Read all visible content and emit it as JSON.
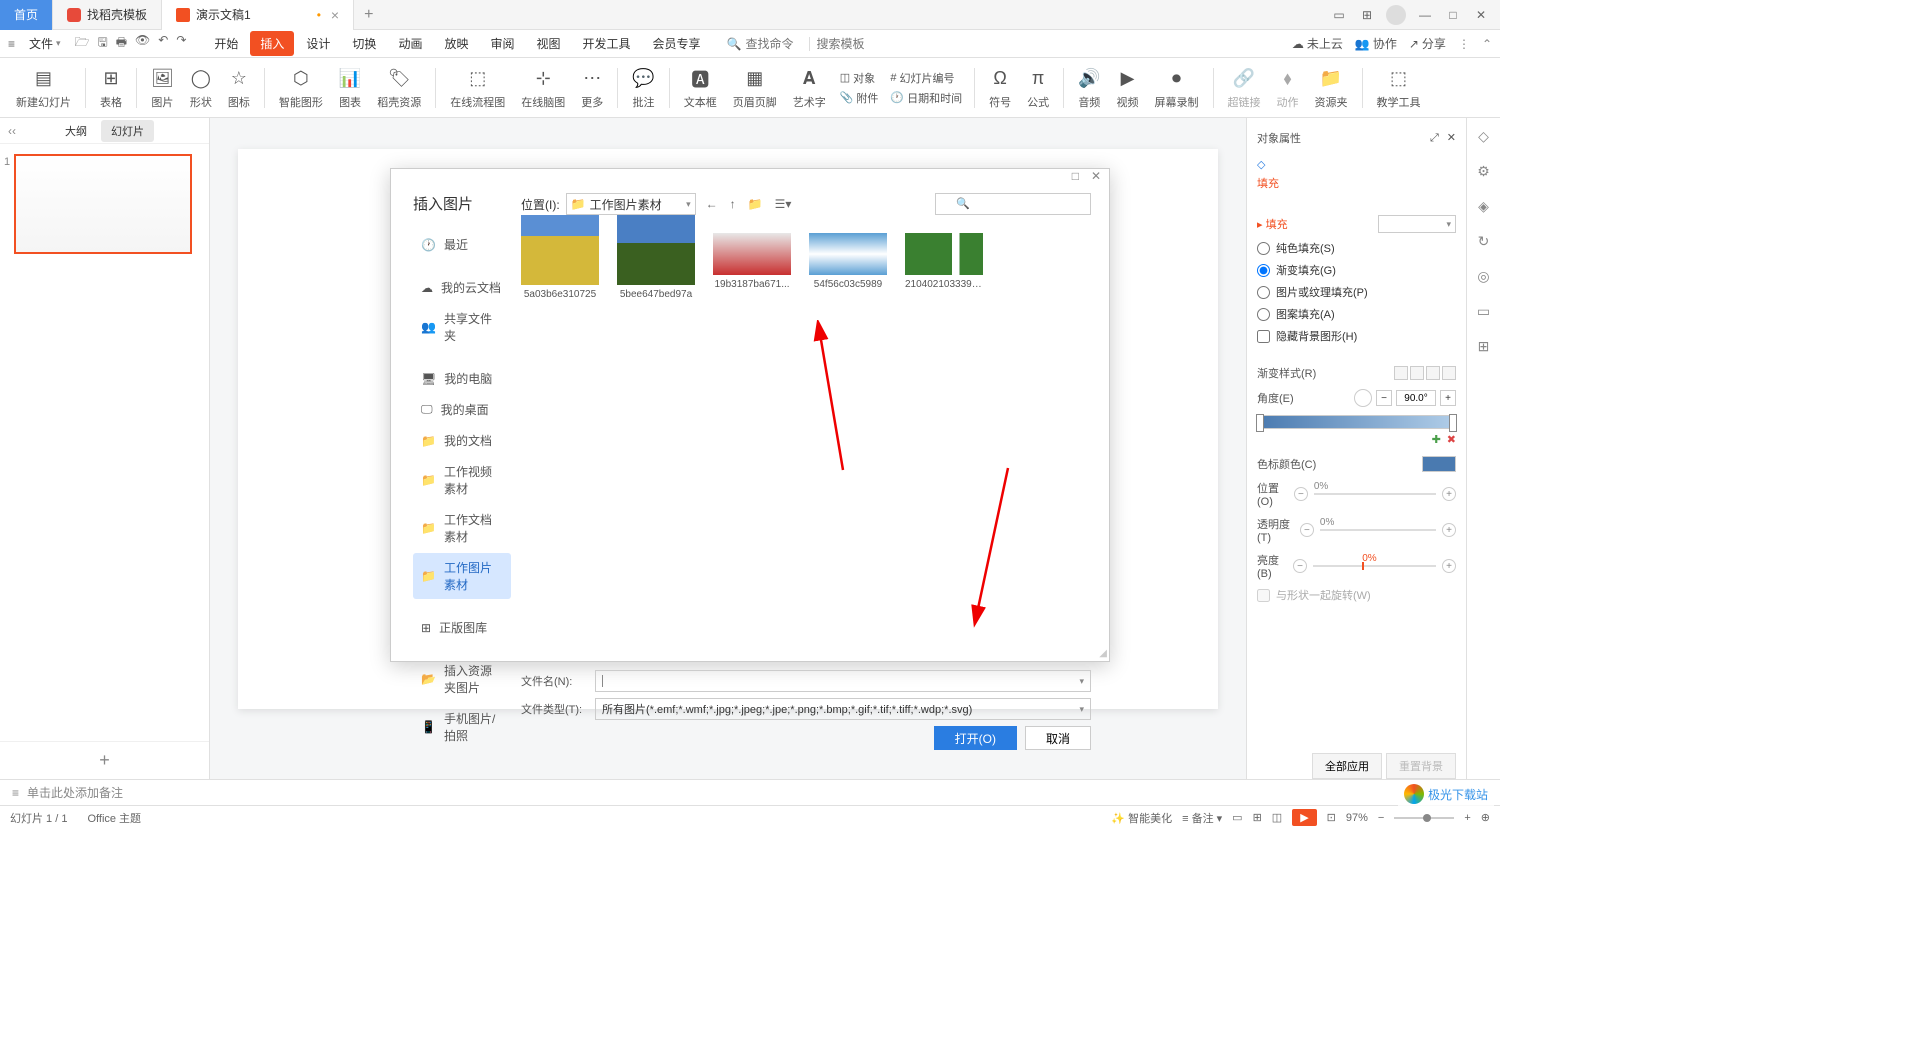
{
  "titlebar": {
    "tabs": [
      {
        "label": "首页",
        "type": "home"
      },
      {
        "label": "找稻壳模板",
        "type": "template"
      },
      {
        "label": "演示文稿1",
        "type": "doc",
        "modified": true
      }
    ]
  },
  "menubar": {
    "file": "文件",
    "tabs": [
      "开始",
      "插入",
      "设计",
      "切换",
      "动画",
      "放映",
      "审阅",
      "视图",
      "开发工具",
      "会员专享"
    ],
    "active_tab": 1,
    "search_placeholder": "查找命令",
    "template_placeholder": "搜索模板",
    "right": {
      "cloud": "未上云",
      "collab": "协作",
      "share": "分享"
    }
  },
  "ribbon": {
    "items": [
      "新建幻灯片",
      "表格",
      "图片",
      "形状",
      "图标",
      "智能图形",
      "图表",
      "稻壳资源",
      "在线流程图",
      "在线脑图",
      "更多",
      "批注",
      "文本框",
      "页眉页脚",
      "艺术字",
      "对象",
      "幻灯片编号",
      "日期和时间",
      "符号",
      "公式",
      "音频",
      "视频",
      "屏幕录制",
      "超链接",
      "动作",
      "资源夹",
      "教学工具"
    ],
    "attach": "附件"
  },
  "slidepanel": {
    "tabs": [
      "大纲",
      "幻灯片"
    ],
    "active": 1,
    "slide_num": "1"
  },
  "rightpanel": {
    "title": "对象属性",
    "fill_group": "填充",
    "fill_section": "填充",
    "radios": [
      "纯色填充(S)",
      "渐变填充(G)",
      "图片或纹理填充(P)",
      "图案填充(A)"
    ],
    "hide_bg": "隐藏背景图形(H)",
    "gradient_style": "渐变样式(R)",
    "angle": "角度(E)",
    "angle_val": "90.0°",
    "stop_color": "色标颜色(C)",
    "position": "位置(O)",
    "transparency": "透明度(T)",
    "brightness": "亮度(B)",
    "pct": "0%",
    "rotate_with": "与形状一起旋转(W)",
    "bottom_btns": [
      "全部应用",
      "重置背景"
    ]
  },
  "notes": "单击此处添加备注",
  "statusbar": {
    "slide_info": "幻灯片 1 / 1",
    "theme": "Office 主题",
    "beautify": "智能美化",
    "notes_btn": "备注",
    "zoom": "97%"
  },
  "dialog": {
    "title": "插入图片",
    "location_label": "位置(I):",
    "location_value": "工作图片素材",
    "side": {
      "recent": "最近",
      "cloud": "我的云文档",
      "shared": "共享文件夹",
      "computer": "我的电脑",
      "desktop": "我的桌面",
      "documents": "我的文档",
      "video": "工作视频素材",
      "docs": "工作文档素材",
      "images": "工作图片素材",
      "gallery": "正版图库",
      "insert_res": "插入资源夹图片",
      "phone": "手机图片/拍照"
    },
    "files": [
      "5a03b6e310725",
      "5bee647bed97a",
      "19b3187ba671...",
      "54f56c03c5989",
      "210402103339-..."
    ],
    "filename_label": "文件名(N):",
    "filename_value": "",
    "filetype_label": "文件类型(T):",
    "filetype_value": "所有图片(*.emf;*.wmf;*.jpg;*.jpeg;*.jpe;*.png;*.bmp;*.gif;*.tif;*.tiff;*.wdp;*.svg)",
    "open_btn": "打开(O)",
    "cancel_btn": "取消"
  },
  "watermark": "极光下载站"
}
